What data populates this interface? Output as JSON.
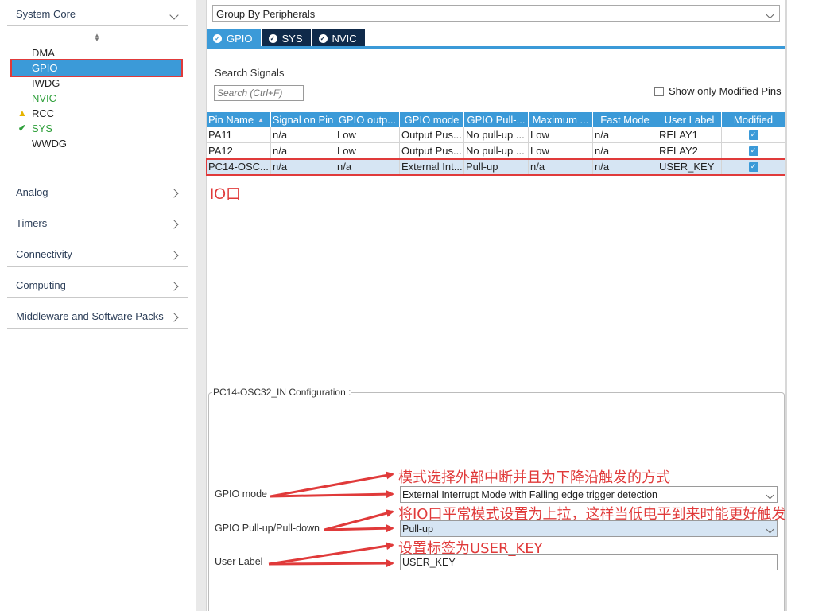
{
  "sidebar": {
    "system_core": "System Core",
    "items": [
      {
        "label": "DMA",
        "status": ""
      },
      {
        "label": "GPIO",
        "status": "selected"
      },
      {
        "label": "IWDG",
        "status": ""
      },
      {
        "label": "NVIC",
        "status": "green"
      },
      {
        "label": "RCC",
        "status": "warning"
      },
      {
        "label": "SYS",
        "status": "ok"
      },
      {
        "label": "WWDG",
        "status": ""
      }
    ],
    "categories": [
      "Analog",
      "Timers",
      "Connectivity",
      "Computing",
      "Middleware and Software Packs"
    ]
  },
  "main": {
    "group_by": "Group By Peripherals",
    "tabs": [
      "GPIO",
      "SYS",
      "NVIC"
    ],
    "search_label": "Search Signals",
    "search_placeholder": "Search (Ctrl+F)",
    "show_modified": "Show only Modified Pins",
    "table": {
      "headers": [
        "Pin Name",
        "Signal on Pin",
        "GPIO outp...",
        "GPIO mode",
        "GPIO Pull-...",
        "Maximum ...",
        "Fast Mode",
        "User Label",
        "Modified"
      ],
      "rows": [
        [
          "PA11",
          "n/a",
          "Low",
          "Output Pus...",
          "No pull-up ...",
          "Low",
          "n/a",
          "RELAY1",
          true
        ],
        [
          "PA12",
          "n/a",
          "Low",
          "Output Pus...",
          "No pull-up ...",
          "Low",
          "n/a",
          "RELAY2",
          true
        ],
        [
          "PC14-OSC...",
          "n/a",
          "n/a",
          "External Int...",
          "Pull-up",
          "n/a",
          "n/a",
          "USER_KEY",
          true
        ]
      ]
    },
    "io_annotation": "IO口",
    "config": {
      "title": "PC14-OSC32_IN Configuration :",
      "gpio_mode_label": "GPIO mode",
      "gpio_mode_value": "External Interrupt Mode with Falling edge trigger detection",
      "pull_label": "GPIO Pull-up/Pull-down",
      "pull_value": "Pull-up",
      "user_label_label": "User Label",
      "user_label_value": "USER_KEY"
    }
  },
  "annotations": {
    "a1": "模式选择外部中断并且为下降沿触发的方式",
    "a2": "将IO口平常模式设置为上拉，这样当低电平到来时能更好触发",
    "a3": "设置标签为USER_KEY"
  },
  "colors": {
    "accent": "#3b9ad8",
    "dark_tab": "#0f2a4a",
    "annotation": "#e03a3a"
  }
}
